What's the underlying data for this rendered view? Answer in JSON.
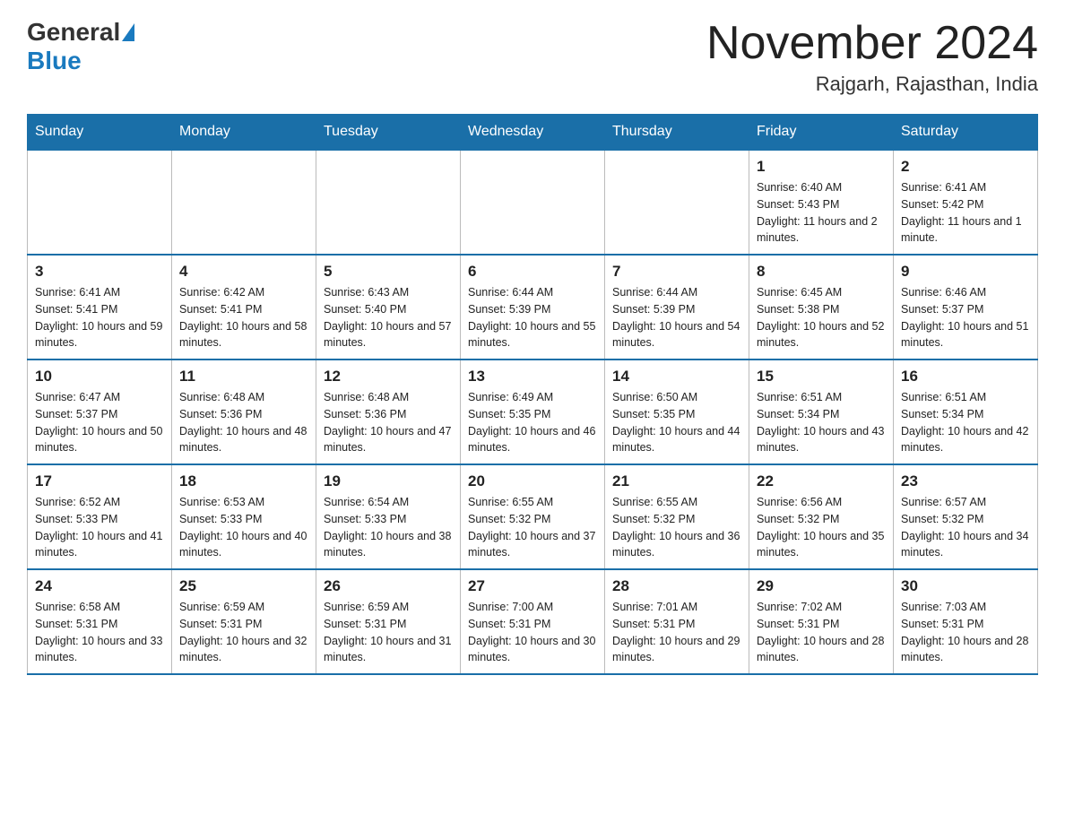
{
  "header": {
    "logo_general": "General",
    "logo_blue": "Blue",
    "month_title": "November 2024",
    "location": "Rajgarh, Rajasthan, India"
  },
  "weekdays": [
    "Sunday",
    "Monday",
    "Tuesday",
    "Wednesday",
    "Thursday",
    "Friday",
    "Saturday"
  ],
  "weeks": [
    [
      {
        "day": "",
        "info": ""
      },
      {
        "day": "",
        "info": ""
      },
      {
        "day": "",
        "info": ""
      },
      {
        "day": "",
        "info": ""
      },
      {
        "day": "",
        "info": ""
      },
      {
        "day": "1",
        "info": "Sunrise: 6:40 AM\nSunset: 5:43 PM\nDaylight: 11 hours and 2 minutes."
      },
      {
        "day": "2",
        "info": "Sunrise: 6:41 AM\nSunset: 5:42 PM\nDaylight: 11 hours and 1 minute."
      }
    ],
    [
      {
        "day": "3",
        "info": "Sunrise: 6:41 AM\nSunset: 5:41 PM\nDaylight: 10 hours and 59 minutes."
      },
      {
        "day": "4",
        "info": "Sunrise: 6:42 AM\nSunset: 5:41 PM\nDaylight: 10 hours and 58 minutes."
      },
      {
        "day": "5",
        "info": "Sunrise: 6:43 AM\nSunset: 5:40 PM\nDaylight: 10 hours and 57 minutes."
      },
      {
        "day": "6",
        "info": "Sunrise: 6:44 AM\nSunset: 5:39 PM\nDaylight: 10 hours and 55 minutes."
      },
      {
        "day": "7",
        "info": "Sunrise: 6:44 AM\nSunset: 5:39 PM\nDaylight: 10 hours and 54 minutes."
      },
      {
        "day": "8",
        "info": "Sunrise: 6:45 AM\nSunset: 5:38 PM\nDaylight: 10 hours and 52 minutes."
      },
      {
        "day": "9",
        "info": "Sunrise: 6:46 AM\nSunset: 5:37 PM\nDaylight: 10 hours and 51 minutes."
      }
    ],
    [
      {
        "day": "10",
        "info": "Sunrise: 6:47 AM\nSunset: 5:37 PM\nDaylight: 10 hours and 50 minutes."
      },
      {
        "day": "11",
        "info": "Sunrise: 6:48 AM\nSunset: 5:36 PM\nDaylight: 10 hours and 48 minutes."
      },
      {
        "day": "12",
        "info": "Sunrise: 6:48 AM\nSunset: 5:36 PM\nDaylight: 10 hours and 47 minutes."
      },
      {
        "day": "13",
        "info": "Sunrise: 6:49 AM\nSunset: 5:35 PM\nDaylight: 10 hours and 46 minutes."
      },
      {
        "day": "14",
        "info": "Sunrise: 6:50 AM\nSunset: 5:35 PM\nDaylight: 10 hours and 44 minutes."
      },
      {
        "day": "15",
        "info": "Sunrise: 6:51 AM\nSunset: 5:34 PM\nDaylight: 10 hours and 43 minutes."
      },
      {
        "day": "16",
        "info": "Sunrise: 6:51 AM\nSunset: 5:34 PM\nDaylight: 10 hours and 42 minutes."
      }
    ],
    [
      {
        "day": "17",
        "info": "Sunrise: 6:52 AM\nSunset: 5:33 PM\nDaylight: 10 hours and 41 minutes."
      },
      {
        "day": "18",
        "info": "Sunrise: 6:53 AM\nSunset: 5:33 PM\nDaylight: 10 hours and 40 minutes."
      },
      {
        "day": "19",
        "info": "Sunrise: 6:54 AM\nSunset: 5:33 PM\nDaylight: 10 hours and 38 minutes."
      },
      {
        "day": "20",
        "info": "Sunrise: 6:55 AM\nSunset: 5:32 PM\nDaylight: 10 hours and 37 minutes."
      },
      {
        "day": "21",
        "info": "Sunrise: 6:55 AM\nSunset: 5:32 PM\nDaylight: 10 hours and 36 minutes."
      },
      {
        "day": "22",
        "info": "Sunrise: 6:56 AM\nSunset: 5:32 PM\nDaylight: 10 hours and 35 minutes."
      },
      {
        "day": "23",
        "info": "Sunrise: 6:57 AM\nSunset: 5:32 PM\nDaylight: 10 hours and 34 minutes."
      }
    ],
    [
      {
        "day": "24",
        "info": "Sunrise: 6:58 AM\nSunset: 5:31 PM\nDaylight: 10 hours and 33 minutes."
      },
      {
        "day": "25",
        "info": "Sunrise: 6:59 AM\nSunset: 5:31 PM\nDaylight: 10 hours and 32 minutes."
      },
      {
        "day": "26",
        "info": "Sunrise: 6:59 AM\nSunset: 5:31 PM\nDaylight: 10 hours and 31 minutes."
      },
      {
        "day": "27",
        "info": "Sunrise: 7:00 AM\nSunset: 5:31 PM\nDaylight: 10 hours and 30 minutes."
      },
      {
        "day": "28",
        "info": "Sunrise: 7:01 AM\nSunset: 5:31 PM\nDaylight: 10 hours and 29 minutes."
      },
      {
        "day": "29",
        "info": "Sunrise: 7:02 AM\nSunset: 5:31 PM\nDaylight: 10 hours and 28 minutes."
      },
      {
        "day": "30",
        "info": "Sunrise: 7:03 AM\nSunset: 5:31 PM\nDaylight: 10 hours and 28 minutes."
      }
    ]
  ]
}
